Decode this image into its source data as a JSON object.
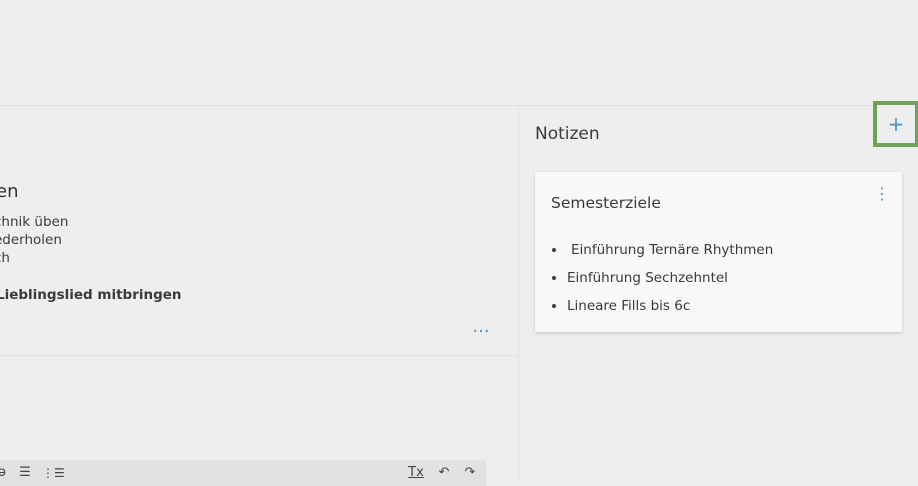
{
  "left": {
    "lesson_title": "en",
    "lines": [
      "chnik üben",
      "ederholen",
      "ch"
    ],
    "bold_line": "Lieblingslied mitbringen",
    "more_label": "···"
  },
  "toolbar": {
    "strike": "ə",
    "bullet_list": "☰",
    "numbered_list": "⋮☰",
    "clear_format": "Tx",
    "undo": "↶",
    "redo": "↷"
  },
  "notes": {
    "title": "Notizen",
    "add_label": "+",
    "card": {
      "title": "Semesterziele",
      "menu_label": "⋮",
      "items": [
        "Einführung Ternäre Rhythmen",
        "Einführung Sechzehntel",
        "Lineare Fills bis 6c"
      ]
    }
  },
  "colors": {
    "accent": "#4a90c8",
    "highlight_border": "#6fa35a"
  }
}
